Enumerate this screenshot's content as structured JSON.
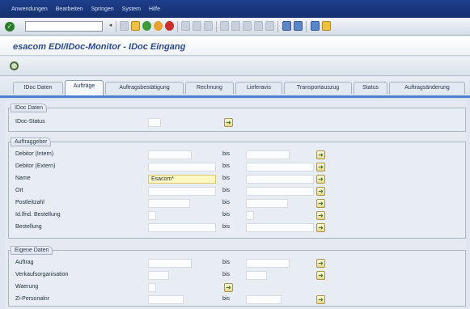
{
  "menu": [
    "Anwendungen",
    "Bearbeiten",
    "Springen",
    "System",
    "Hilfe"
  ],
  "title": "esacom EDI/IDoc-Monitor - IDoc Eingang",
  "tabs": [
    "IDoc Daten",
    "Aufträge",
    "Auftragsbestätigung",
    "Rechnung",
    "Lieferavis",
    "Transportauszug",
    "Status",
    "Auftragsänderung"
  ],
  "active_tab": "Aufträge",
  "bis_label": "bis",
  "groups": {
    "idoc": {
      "title": "IDoc Daten",
      "rows": [
        {
          "label": "IDoc-Status",
          "value": ""
        }
      ]
    },
    "auftraggeber": {
      "title": "Auftraggeber",
      "rows": [
        {
          "label": "Debitor (Intern)",
          "from": "",
          "to": ""
        },
        {
          "label": "Debitor (Extern)",
          "from": "",
          "to": ""
        },
        {
          "label": "Name",
          "from": "Esacom*",
          "to": ""
        },
        {
          "label": "Ort",
          "from": "",
          "to": ""
        },
        {
          "label": "Postleitzahl",
          "from": "",
          "to": ""
        },
        {
          "label": "Id.lfnd. Bestellung",
          "from": "",
          "to": ""
        },
        {
          "label": "Bestellung",
          "from": "",
          "to": ""
        }
      ]
    },
    "eigene": {
      "title": "Eigene Daten",
      "rows": [
        {
          "label": "Auftrag",
          "from": "",
          "to": ""
        },
        {
          "label": "Verkaufsorganisation",
          "from": "",
          "to": ""
        },
        {
          "label": "Waerung",
          "from": ""
        },
        {
          "label": "Zi-Personalnr",
          "from": "",
          "to": ""
        }
      ]
    }
  },
  "icons": {
    "enter": "green-check-icon",
    "save": "save-icon",
    "back": "green-circle-icon",
    "exit": "orange-circle-icon",
    "cancel": "red-circle-icon",
    "execute": "execute-clock-icon",
    "multiple_selection": "multiple-selection-arrow-icon"
  }
}
